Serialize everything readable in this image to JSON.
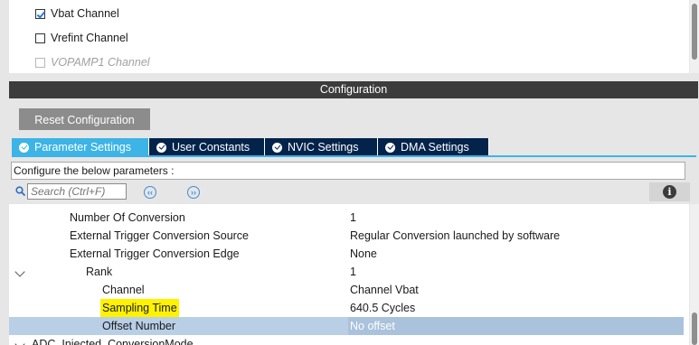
{
  "channels": [
    {
      "label": "Vbat Channel",
      "checked": true,
      "disabled": false
    },
    {
      "label": "Vrefint Channel",
      "checked": false,
      "disabled": false
    },
    {
      "label": "VOPAMP1 Channel",
      "checked": false,
      "disabled": true
    }
  ],
  "configuration": {
    "title": "Configuration",
    "reset_label": "Reset Configuration"
  },
  "tabs": [
    {
      "label": "Parameter Settings",
      "active": true
    },
    {
      "label": "User Constants",
      "active": false
    },
    {
      "label": "NVIC Settings",
      "active": false
    },
    {
      "label": "DMA Settings",
      "active": false
    }
  ],
  "config_desc": "Configure the below parameters :",
  "search": {
    "placeholder": "Search (Ctrl+F)"
  },
  "params": [
    {
      "name": "Number Of Conversion",
      "value": "1"
    },
    {
      "name": "External Trigger Conversion Source",
      "value": "Regular Conversion launched by software"
    },
    {
      "name": "External Trigger Conversion Edge",
      "value": "None"
    },
    {
      "name": "Rank",
      "value": "1"
    },
    {
      "name": "Channel",
      "value": "Channel Vbat"
    },
    {
      "name": "Sampling Time",
      "value": "640.5 Cycles"
    },
    {
      "name": "Offset Number",
      "value": "No offset"
    },
    {
      "name": "ADC_Injected_ConversionMode",
      "value": ""
    }
  ],
  "colors": {
    "tab_active": "#3cb4e6",
    "tab_inactive": "#03234b",
    "highlight": "#fff200",
    "selected_row": "#b8cfe6"
  }
}
